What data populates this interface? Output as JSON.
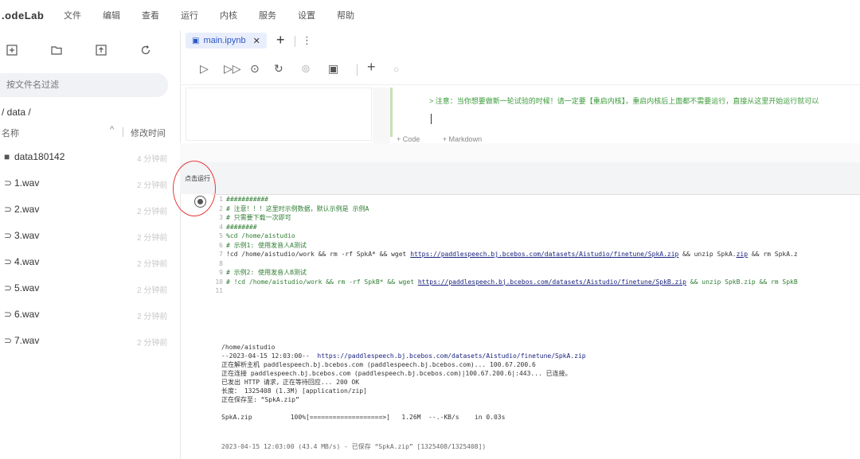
{
  "menubar": {
    "logo": ".odeLab",
    "items": [
      "文件",
      "编辑",
      "查看",
      "运行",
      "内核",
      "服务",
      "设置",
      "帮助"
    ]
  },
  "sidebar": {
    "filter_placeholder": "按文件名过滤",
    "path": "/ data /",
    "col_name": "名称",
    "col_modified": "修改时间",
    "files": [
      {
        "name": "data180142",
        "time": "4 分钟前",
        "type": "folder"
      },
      {
        "name": "1.wav",
        "time": "2 分钟前",
        "type": "file"
      },
      {
        "name": "2.wav",
        "time": "2 分钟前",
        "type": "file"
      },
      {
        "name": "3.wav",
        "time": "2 分钟前",
        "type": "file"
      },
      {
        "name": "4.wav",
        "time": "2 分钟前",
        "type": "file"
      },
      {
        "name": "5.wav",
        "time": "2 分钟前",
        "type": "file"
      },
      {
        "name": "6.wav",
        "time": "2 分钟前",
        "type": "file"
      },
      {
        "name": "7.wav",
        "time": "2 分钟前",
        "type": "file"
      }
    ]
  },
  "tab": {
    "label": "main.ipynb"
  },
  "markdown_note": "> 注意：当你想要做新一轮试验的时候！请一定要【重启内核】，重启内核后上面都不需要运行，直接从这里开始运行就可以",
  "add_cell": {
    "code": "+ Code",
    "markdown": "+ Markdown"
  },
  "run_label": "点击运行",
  "code_lines": [
    {
      "n": "1",
      "parts": [
        {
          "c": "cm",
          "t": "###########"
        }
      ]
    },
    {
      "n": "2",
      "parts": [
        {
          "c": "cm",
          "t": "# 注意！！！这里时示例数据，默认示例是 示例A"
        }
      ]
    },
    {
      "n": "3",
      "parts": [
        {
          "c": "cm",
          "t": "# 只需要下载一次即可"
        }
      ]
    },
    {
      "n": "4",
      "parts": [
        {
          "c": "cm",
          "t": "########"
        }
      ]
    },
    {
      "n": "5",
      "parts": [
        {
          "c": "cm",
          "t": "%cd /home/aistudio"
        }
      ]
    },
    {
      "n": "6",
      "parts": [
        {
          "c": "cm",
          "t": "# 示例1: 使用发音人A测试"
        }
      ]
    },
    {
      "n": "7",
      "parts": [
        {
          "c": "cmd",
          "t": "!cd /home/aistudio/work && rm -rf SpkA* && wget "
        },
        {
          "c": "link",
          "t": "https://paddlespeech.bj.bcebos.com/datasets/Aistudio/finetune/SpkA.zip"
        },
        {
          "c": "cmd",
          "t": " && unzip SpkA."
        },
        {
          "c": "link",
          "t": "zip"
        },
        {
          "c": "cmd",
          "t": " && rm SpkA.z"
        }
      ]
    },
    {
      "n": "8",
      "parts": [
        {
          "c": "cmd",
          "t": ""
        }
      ]
    },
    {
      "n": "9",
      "parts": [
        {
          "c": "cm",
          "t": "# 示例2: 使用发音人B测试"
        }
      ]
    },
    {
      "n": "10",
      "parts": [
        {
          "c": "cm",
          "t": "# !cd /home/aistudio/work && rm -rf SpkB* && wget "
        },
        {
          "c": "link",
          "t": "https://paddlespeech.bj.bcebos.com/datasets/Aistudio/finetune/SpkB.zip"
        },
        {
          "c": "cm",
          "t": " && unzip SpkB.zip && rm SpkB"
        }
      ]
    },
    {
      "n": "11",
      "parts": [
        {
          "c": "cmd",
          "t": ""
        }
      ]
    }
  ],
  "output_lines": [
    {
      "parts": [
        {
          "c": "",
          "t": "/home/aistudio"
        }
      ]
    },
    {
      "parts": [
        {
          "c": "",
          "t": "--2023-04-15 12:03:00--  "
        },
        {
          "c": "link",
          "t": "https://paddlespeech.bj.bcebos.com/datasets/Aistudio/finetune/SpkA.zip"
        }
      ]
    },
    {
      "parts": [
        {
          "c": "",
          "t": "正在解析主机 paddlespeech.bj.bcebos.com (paddlespeech.bj.bcebos.com)... 100.67.200.6"
        }
      ]
    },
    {
      "parts": [
        {
          "c": "",
          "t": "正在连接 paddlespeech.bj.bcebos.com (paddlespeech.bj.bcebos.com)|100.67.200.6|:443... 已连接。"
        }
      ]
    },
    {
      "parts": [
        {
          "c": "",
          "t": "已发出 HTTP 请求，正在等待回应... 200 OK"
        }
      ]
    },
    {
      "parts": [
        {
          "c": "",
          "t": "长度： 1325408 (1.3M) [application/zip]"
        }
      ]
    },
    {
      "parts": [
        {
          "c": "",
          "t": "正在保存至: “SpkA.zip”"
        }
      ]
    },
    {
      "parts": [
        {
          "c": "",
          "t": " "
        }
      ]
    },
    {
      "parts": [
        {
          "c": "",
          "t": "SpkA.zip          100%[===================>]   1.26M  --.-KB/s    in 0.03s"
        }
      ]
    }
  ],
  "output_bottom": "2023-04-15 12:03:00 (43.4 MB/s) - 已保存 “SpkA.zip” [1325408/1325408])"
}
